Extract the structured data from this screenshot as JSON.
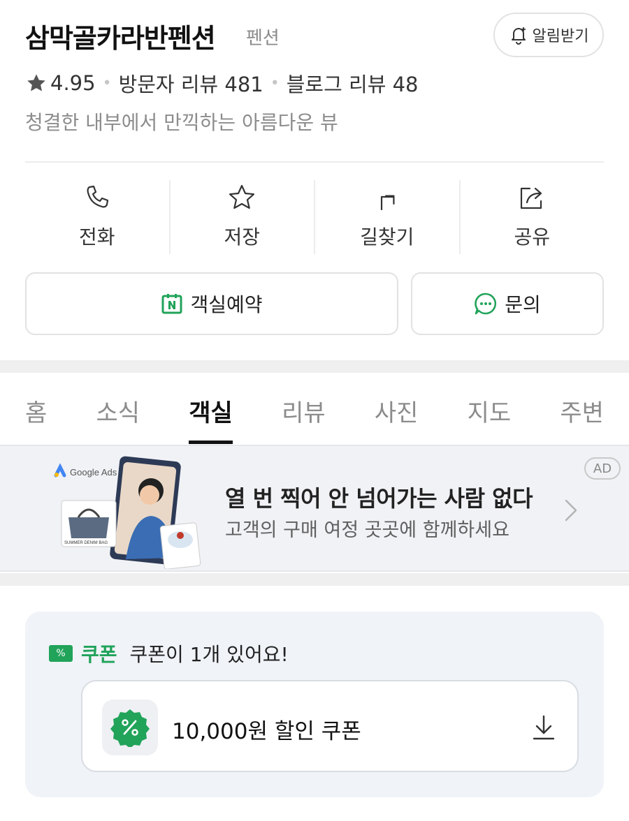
{
  "header": {
    "title": "삼막골카라반펜션",
    "category": "펜션",
    "alarm_label": "알림받기"
  },
  "meta": {
    "rating": "4.95",
    "visitor_reviews": "방문자 리뷰 481",
    "blog_reviews": "블로그 리뷰 48",
    "tagline": "청결한 내부에서 만끽하는 아름다운 뷰"
  },
  "actions": [
    {
      "label": "전화",
      "icon": "phone-icon"
    },
    {
      "label": "저장",
      "icon": "star-outline-icon"
    },
    {
      "label": "길찾기",
      "icon": "directions-icon"
    },
    {
      "label": "공유",
      "icon": "share-icon"
    }
  ],
  "buttons": {
    "reserve": "객실예약",
    "inquiry": "문의"
  },
  "tabs": [
    {
      "label": "홈",
      "active": false
    },
    {
      "label": "소식",
      "active": false
    },
    {
      "label": "객실",
      "active": true
    },
    {
      "label": "리뷰",
      "active": false
    },
    {
      "label": "사진",
      "active": false
    },
    {
      "label": "지도",
      "active": false
    },
    {
      "label": "주변",
      "active": false
    }
  ],
  "ad": {
    "badge": "AD",
    "brand": "Google Ads",
    "headline": "열 번 찍어 안 넘어가는 사람 없다",
    "subline": "고객의 구매 여정 곳곳에 함께하세요",
    "product_label": "SUMMER DENIM BAG"
  },
  "coupon": {
    "tag": "%",
    "label": "쿠폰",
    "count_text": "쿠폰이 1개 있어요!",
    "name": "10,000원 할인 쿠폰"
  },
  "colors": {
    "accent_green": "#21a35a",
    "text_primary": "#111111",
    "text_secondary": "#8c8c8c"
  }
}
